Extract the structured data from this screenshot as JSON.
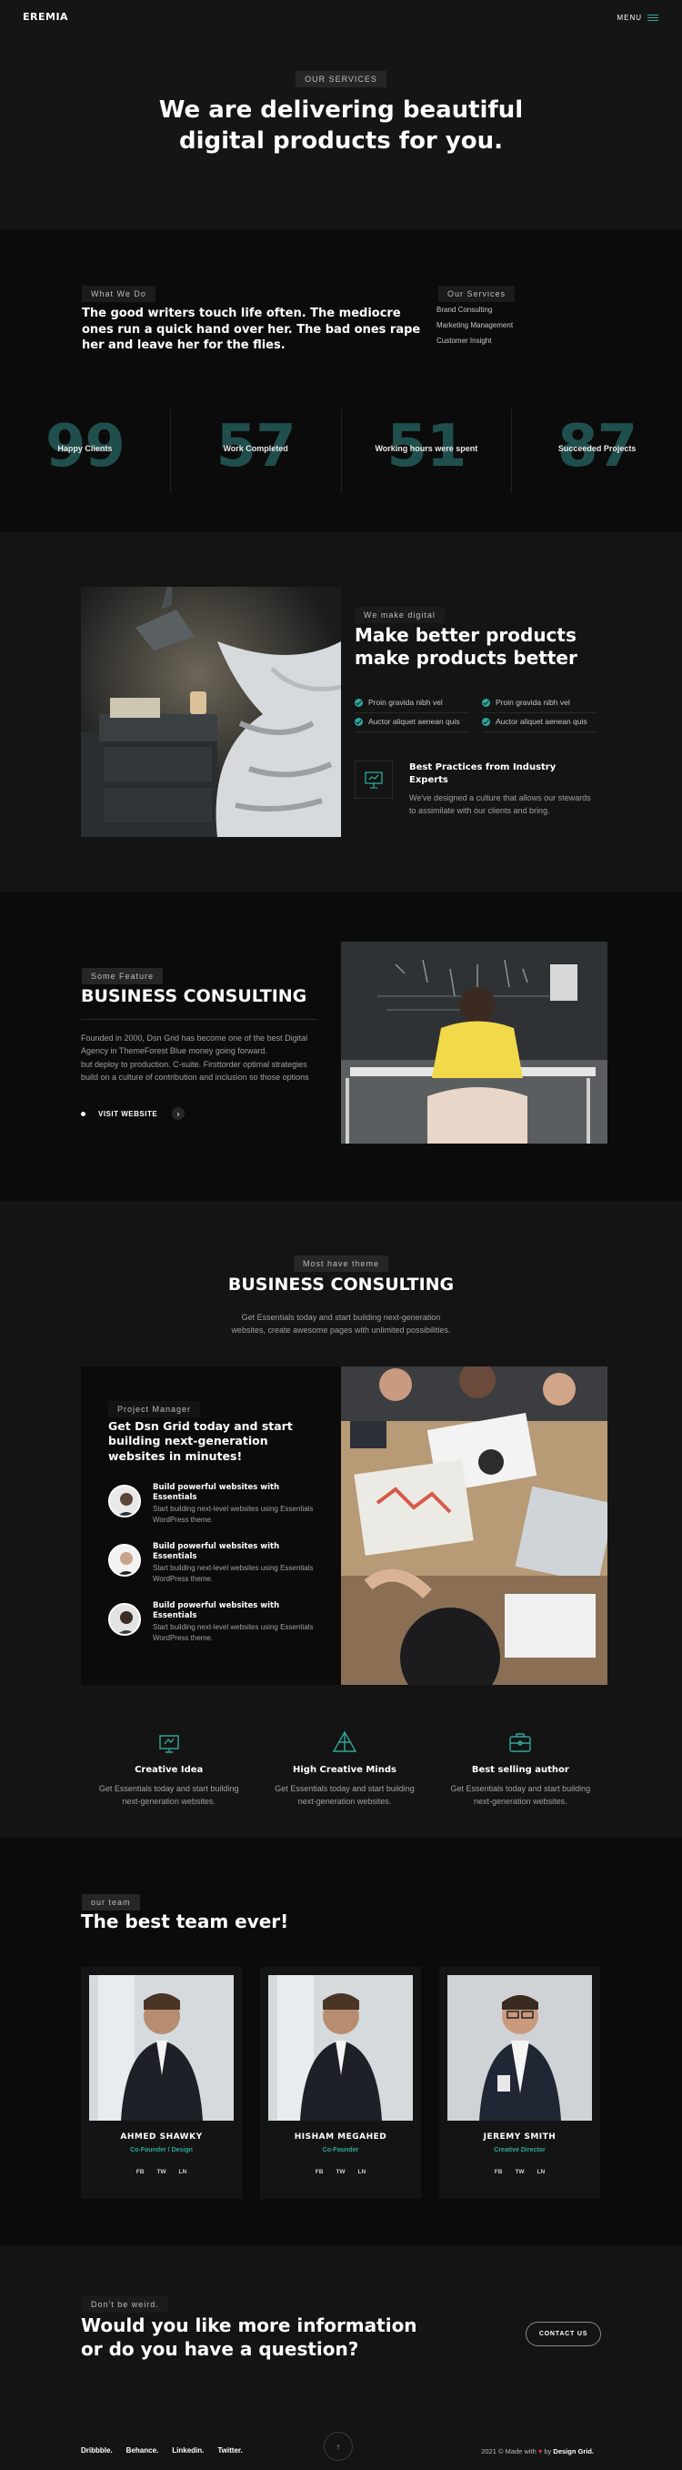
{
  "header": {
    "logo": "EREMIA",
    "menu_label": "MENU"
  },
  "hero": {
    "pill": "OUR SERVICES",
    "title_line1": "We are delivering beautiful",
    "title_line2": "digital products for you."
  },
  "what_we_do": {
    "pill": "What We Do",
    "text": "The good writers touch life often. The mediocre ones run a quick hand over her. The bad ones rape her and leave her for the flies.",
    "services_pill": "Our Services",
    "services": [
      "Brand Consulting",
      "Marketing Management",
      "Customer Insight"
    ]
  },
  "stats": [
    {
      "number": "99",
      "label": "Happy Clients"
    },
    {
      "number": "57",
      "label": "Work Completed"
    },
    {
      "number": "51",
      "label": "Working hours were spent"
    },
    {
      "number": "87",
      "label": "Succeeded Projects"
    }
  ],
  "better": {
    "pill": "We make digital",
    "title_line1": "Make better products",
    "title_line2": "make products better",
    "checks": [
      "Proin gravida nibh vel",
      "Proin gravida nibh vel",
      "Auctor aliquet aenean quis",
      "Auctor aliquet aenean quis"
    ],
    "best_title": "Best Practices from Industry Experts",
    "best_text": "We've designed a culture that allows our stewards to assimilate with our clients and bring.",
    "icon": "presentation-icon"
  },
  "feature": {
    "pill": "Some Feature",
    "title": "BUSINESS CONSULTING",
    "p1": "Founded in 2000, Dsn Grid has become one of the best Digital Agency in ThemeForest Blue money going forward.",
    "p2": "but deploy to production. C-suite. Firsttorder optimal strategies build on a culture of contribution and inclusion so those options",
    "link": "VISIT WEBSITE"
  },
  "bc2": {
    "pill": "Most have theme",
    "title": "BUSINESS CONSULTING",
    "subtitle": "Get Essentials today and start building next-generation websites, create awesome pages with unlimited possibilities.",
    "card": {
      "pill": "Project Manager",
      "title": "Get Dsn Grid today and start building next-generation websites in minutes!",
      "items": [
        {
          "title": "Build powerful websites with Essentials",
          "text": "Start building next-level websites using Essentials WordPress theme."
        },
        {
          "title": "Build powerful websites with Essentials",
          "text": "Start building next-level websites using Essentials WordPress theme."
        },
        {
          "title": "Build powerful websites with Essentials",
          "text": "Start building next-level websites using Essentials WordPress theme."
        }
      ]
    },
    "features": [
      {
        "icon": "creative-idea-icon",
        "title": "Creative Idea",
        "text": "Get Essentials today and start building next-generation websites."
      },
      {
        "icon": "pyramid-icon",
        "title": "High Creative Minds",
        "text": "Get Essentials today and start building next-generation websites."
      },
      {
        "icon": "briefcase-icon",
        "title": "Best selling author",
        "text": "Get Essentials today and start building next-generation websites."
      }
    ]
  },
  "team": {
    "pill": "our team",
    "title": "The best team ever!",
    "members": [
      {
        "name": "AHMED SHAWKY",
        "role": "Co-Founder / Design",
        "social": [
          "FB",
          "TW",
          "LN"
        ]
      },
      {
        "name": "HISHAM MEGAHED",
        "role": "Co-Founder",
        "social": [
          "FB",
          "TW",
          "LN"
        ]
      },
      {
        "name": "JEREMY SMITH",
        "role": "Creative Director",
        "social": [
          "FB",
          "TW",
          "LN"
        ]
      }
    ]
  },
  "contact": {
    "pill": "Don't be weird.",
    "title_line1": "Would you like more information",
    "title_line2": "or do you have a question?",
    "button": "CONTACT US"
  },
  "footer": {
    "social": [
      "Dribbble.",
      "Behance.",
      "Linkedin.",
      "Twitter."
    ],
    "copy_prefix": "2021 © Made with",
    "heart": "♥",
    "copy_by": "by",
    "copy_brand": "Design Grid.",
    "top_arrow": "↑"
  },
  "colors": {
    "accent": "#2fa89c",
    "bg": "#141414",
    "bg_dark": "#0b0b0b",
    "stat_number": "#1f4f4c"
  }
}
